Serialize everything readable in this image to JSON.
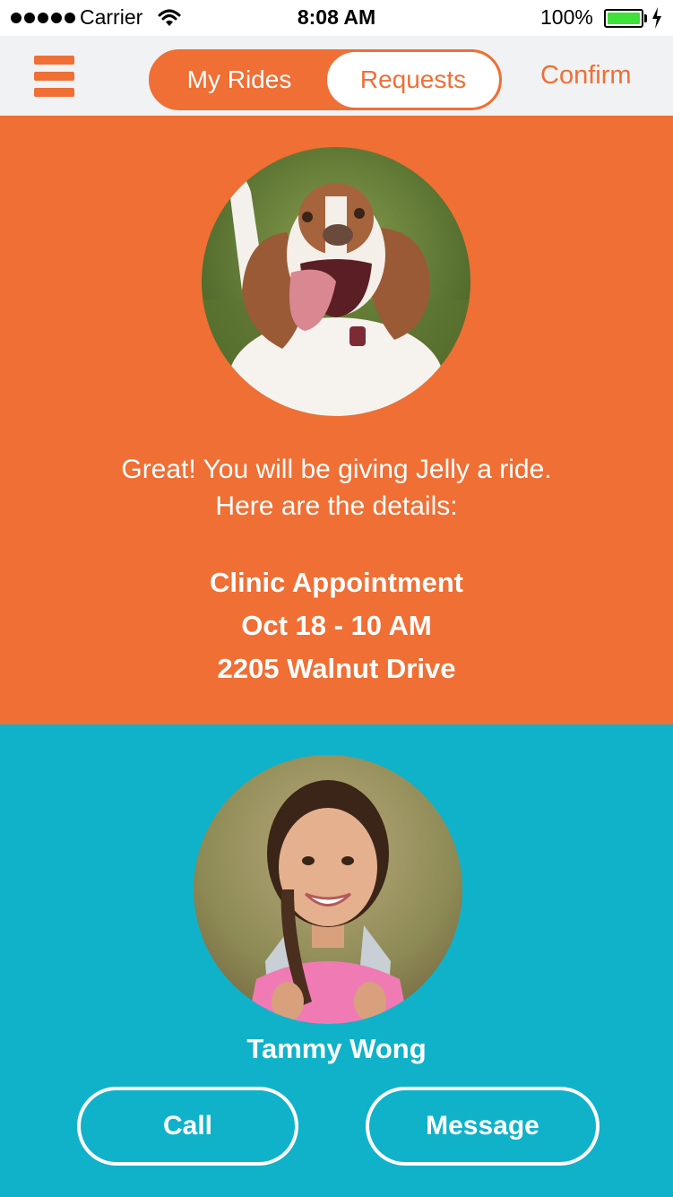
{
  "status_bar": {
    "carrier": "Carrier",
    "time": "8:08 AM",
    "battery": "100%"
  },
  "nav": {
    "tabs": [
      {
        "label": "My Rides",
        "selected": false
      },
      {
        "label": "Requests",
        "selected": true
      }
    ],
    "confirm_label": "Confirm"
  },
  "ride": {
    "intro_line1": "Great! You will be giving Jelly a ride.",
    "intro_line2": "Here are the details:",
    "title": "Clinic Appointment",
    "when": "Oct 18 - 10 AM",
    "address": "2205 Walnut Drive"
  },
  "driver": {
    "name": "Tammy Wong",
    "call_label": "Call",
    "message_label": "Message"
  },
  "icons": {
    "menu": "hamburger-menu-icon",
    "wifi": "wifi-icon",
    "battery": "battery-icon",
    "charging": "bolt-icon"
  },
  "colors": {
    "accent": "#ef6f35",
    "teal": "#10b2c9",
    "nav_bg": "#f1f2f3",
    "battery_fill": "#3ee03a"
  }
}
